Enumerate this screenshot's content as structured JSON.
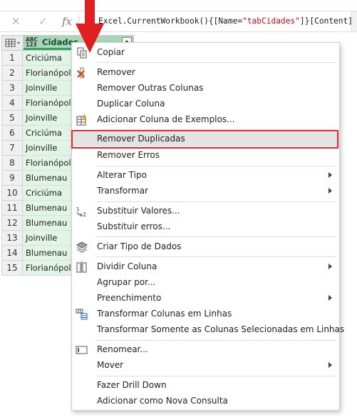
{
  "formula_bar": {
    "cancel_icon": "close-icon",
    "confirm_icon": "check-icon",
    "fx_label": "fx",
    "formula_prefix": "Excel.CurrentWorkbook(){[Name=",
    "formula_string": "\"tabCidades\"",
    "formula_suffix": "]}[Content]"
  },
  "grid": {
    "column_type_badge": "ABC 123",
    "column_title": "Cidades",
    "rows": [
      {
        "num": "1",
        "value": "Criciúma"
      },
      {
        "num": "2",
        "value": "Florianópolis"
      },
      {
        "num": "3",
        "value": "Joinville"
      },
      {
        "num": "4",
        "value": "Florianópolis"
      },
      {
        "num": "5",
        "value": "Joinville"
      },
      {
        "num": "6",
        "value": "Criciúma"
      },
      {
        "num": "7",
        "value": "Joinville"
      },
      {
        "num": "8",
        "value": "Florianópolis"
      },
      {
        "num": "9",
        "value": "Blumenau"
      },
      {
        "num": "10",
        "value": "Criciúma"
      },
      {
        "num": "11",
        "value": "Blumenau"
      },
      {
        "num": "12",
        "value": "Blumenau"
      },
      {
        "num": "13",
        "value": "Joinville"
      },
      {
        "num": "14",
        "value": "Blumenau"
      },
      {
        "num": "15",
        "value": "Florianópolis"
      }
    ]
  },
  "menu": {
    "copy": "Copiar",
    "remove": "Remover",
    "remove_other": "Remover Outras Colunas",
    "duplicate": "Duplicar Coluna",
    "add_from_examples": "Adicionar Coluna de Exemplos...",
    "remove_duplicates": "Remover Duplicadas",
    "remove_errors": "Remover Erros",
    "change_type": "Alterar Tipo",
    "transform": "Transformar",
    "replace_values": "Substituir Valores...",
    "replace_errors": "Substituir erros...",
    "create_data_type": "Criar Tipo de Dados",
    "split_column": "Dividir Coluna",
    "group_by": "Agrupar por...",
    "fill": "Preenchimento",
    "unpivot": "Transformar Colunas em Linhas",
    "unpivot_selected": "Transformar Somente as Colunas Selecionadas em Linhas",
    "rename": "Renomear...",
    "move": "Mover",
    "drill_down": "Fazer Drill Down",
    "add_as_query": "Adicionar como Nova Consulta"
  },
  "colors": {
    "column_header": "#a7d7b8",
    "column_accent": "#35a462",
    "cell_background": "#e2f3e7",
    "highlight_border": "#e02a2a",
    "arrow": "#e02020"
  }
}
